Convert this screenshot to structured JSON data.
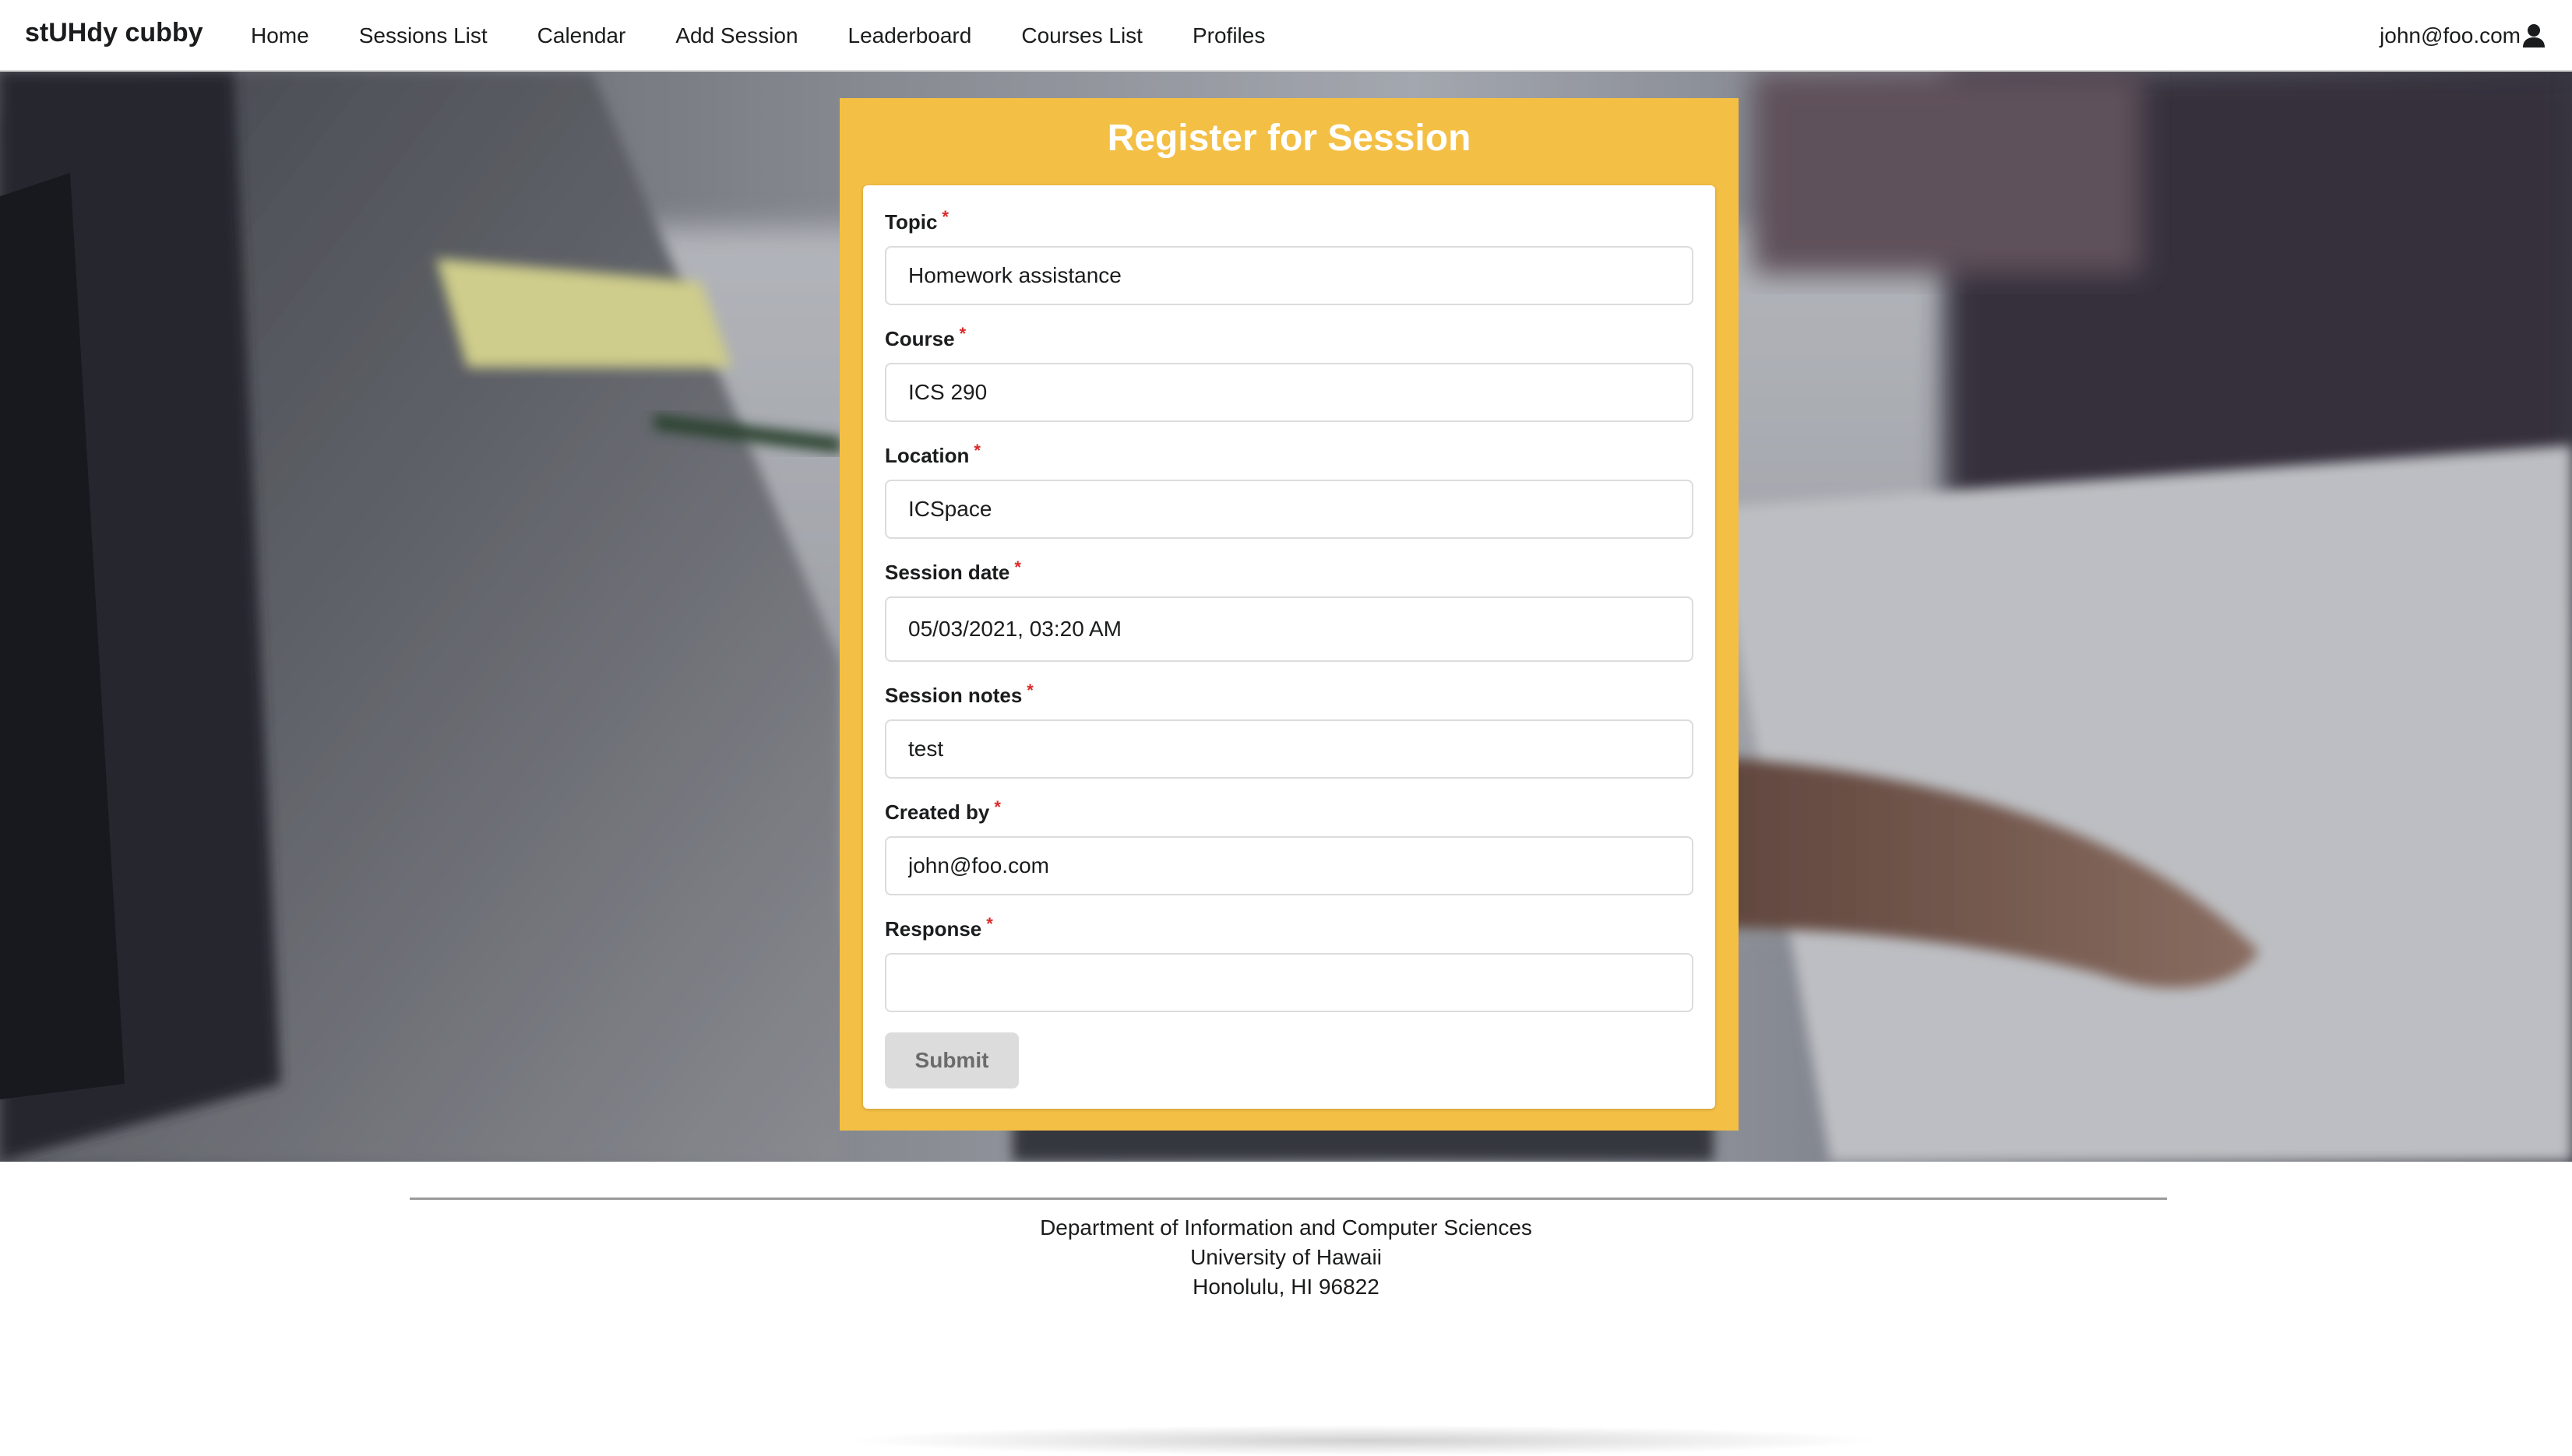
{
  "navbar": {
    "brand": "stUHdy cubby",
    "links": [
      {
        "label": "Home"
      },
      {
        "label": "Sessions List"
      },
      {
        "label": "Calendar"
      },
      {
        "label": "Add Session"
      },
      {
        "label": "Leaderboard"
      },
      {
        "label": "Courses List"
      },
      {
        "label": "Profiles"
      }
    ],
    "user_email": "john@foo.com",
    "user_icon": "user-icon"
  },
  "form": {
    "title": "Register for Session",
    "required_marker": "*",
    "fields": [
      {
        "label": "Topic",
        "value": "Homework assistance"
      },
      {
        "label": "Course",
        "value": "ICS 290"
      },
      {
        "label": "Location",
        "value": "ICSpace"
      },
      {
        "label": "Session date",
        "value": "05/03/2021, 03:20 AM"
      },
      {
        "label": "Session notes",
        "value": "test"
      },
      {
        "label": "Created by",
        "value": "john@foo.com"
      },
      {
        "label": "Response",
        "value": ""
      }
    ],
    "submit_label": "Submit"
  },
  "footer": {
    "line1": "Department of Information and Computer Sciences",
    "line2": "University of Hawaii",
    "line3": "Honolulu, HI 96822"
  },
  "colors": {
    "panel": "#f3bf45",
    "required": "#db2828",
    "submit_bg": "#dcdcdc"
  }
}
